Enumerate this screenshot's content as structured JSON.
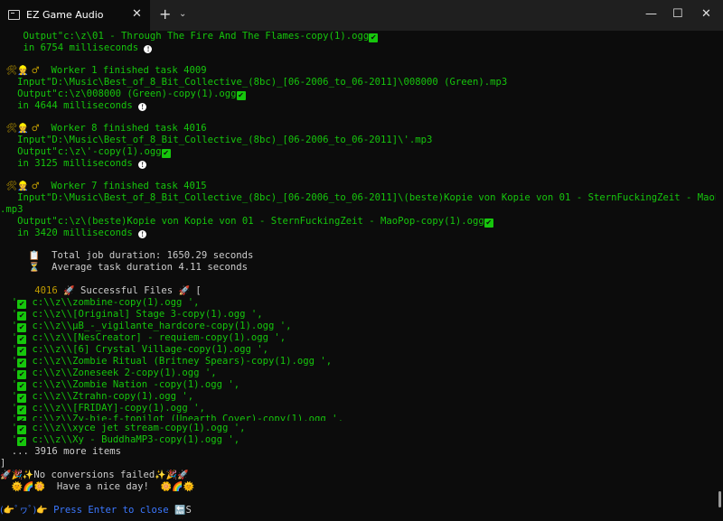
{
  "window": {
    "tab_title": "EZ Game Audio",
    "tab_close": "✕",
    "new_tab": "+",
    "dropdown": "⌄",
    "minimize": "—",
    "maximize": "☐",
    "close": "✕"
  },
  "terminal": {
    "output_prefix": "Output\"",
    "input_prefix": "Input\"",
    "in_word": "in ",
    "ms_word": " milliseconds",
    "worker_icons": "🛠👷 ♂",
    "tasks": [
      {
        "output": "c:\\z\\01 - Through The Fire And The Flames-copy(1).ogg",
        "ms": "6754"
      },
      {
        "header": "Worker 1 finished task 4009",
        "input": "D:\\Music\\Best_of_8_Bit_Collective_(8bc)_[06-2006_to_06-2011]\\008000 (Green).mp3",
        "output": "c:\\z\\008000 (Green)-copy(1).ogg",
        "ms": "4644"
      },
      {
        "header": "Worker 8 finished task 4016",
        "input": "D:\\Music\\Best_of_8_Bit_Collective_(8bc)_[06-2006_to_06-2011]\\'.mp3",
        "output": "c:\\z\\'-copy(1).ogg",
        "ms": "3125"
      },
      {
        "header": "Worker 7 finished task 4015",
        "input": "D:\\Music\\Best_of_8_Bit_Collective_(8bc)_[06-2006_to_06-2011]\\(beste)Kopie von Kopie von 01 - SternFuckingZeit - MaoPop",
        "input_wrap": ".mp3",
        "output": "c:\\z\\(beste)Kopie von Kopie von 01 - SternFuckingZeit - MaoPop-copy(1).ogg",
        "ms": "3420"
      }
    ],
    "summary": {
      "clipboard_icon": "📋",
      "total_label": "Total job duration: 1650.29 seconds",
      "hourglass_icon": "⏳",
      "avg_label": "Average task duration 4.11 seconds"
    },
    "success": {
      "count": "4016",
      "rocket_icon": "🚀",
      "label": "Successful Files",
      "bracket": "[",
      "files": [
        "c:\\\\z\\\\zombine-copy(1).ogg ',",
        "c:\\\\z\\\\[Original] Stage 3-copy(1).ogg ',",
        "c:\\\\z\\\\µB_-_vigilante_hardcore-copy(1).ogg ',",
        "c:\\\\z\\\\[NesCreator] - requiem-copy(1).ogg ',",
        "c:\\\\z\\\\[6] Crystal Village-copy(1).ogg ',",
        "c:\\\\z\\\\Zombie Ritual (Britney Spears)-copy(1).ogg ',",
        "c:\\\\z\\\\Zoneseek 2-copy(1).ogg ',",
        "c:\\\\z\\\\Zombie Nation -copy(1).ogg ',",
        "c:\\\\z\\\\Ztrahn-copy(1).ogg ',",
        "c:\\\\z\\\\[FRIDAY]-copy(1).ogg ',",
        "c:\\\\z\\\\Zy-bie-f-topilot (Unearth Cover)-copy(1).ogg ',",
        "c:\\\\z\\\\xyce jet stream-copy(1).ogg ',",
        "c:\\\\z\\\\Xy - BuddhaMP3-copy(1).ogg ',"
      ],
      "more": "... 3916 more items",
      "close_bracket": "]"
    },
    "footer": {
      "no_fail": "No conversions failed",
      "nice_day": "Have a nice day!",
      "prompt_face": "(👉ﾟヮﾟ)👉",
      "press_enter": "Press Enter to close",
      "end_icon": "🔚",
      "cursor": "S"
    }
  }
}
